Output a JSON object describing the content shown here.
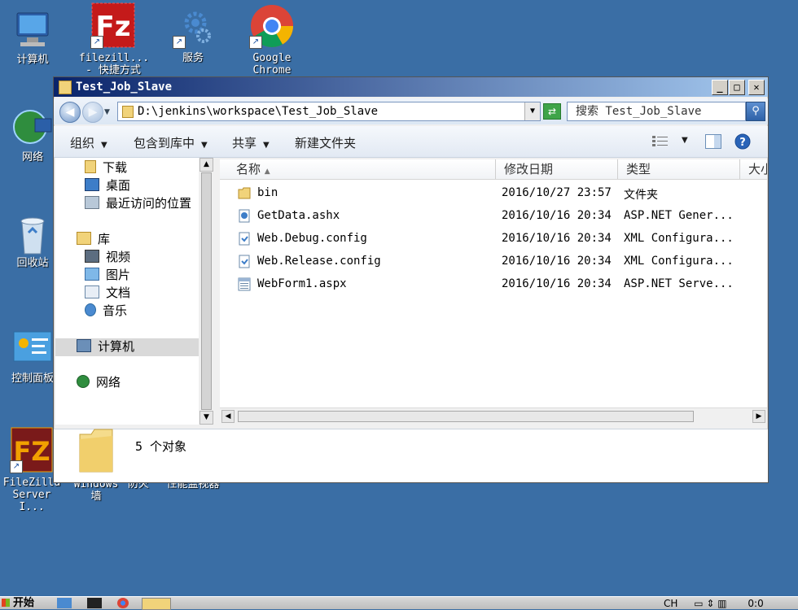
{
  "desktop": {
    "icons": [
      {
        "label": "计算机"
      },
      {
        "label": "filezill...\n- 快捷方式"
      },
      {
        "label": "服务"
      },
      {
        "label": "Google\nChrome"
      },
      {
        "label": "网络"
      },
      {
        "label": "回收站"
      },
      {
        "label": "控制面板"
      },
      {
        "label": "FileZilla\nServer I..."
      },
      {
        "label": "Windows\n墙"
      },
      {
        "label": "防火"
      },
      {
        "label": "性能监视器"
      }
    ]
  },
  "window": {
    "title": "Test_Job_Slave",
    "address": "D:\\jenkins\\workspace\\Test_Job_Slave",
    "search_placeholder": "搜索 Test_Job_Slave",
    "toolbar": {
      "organize": "组织",
      "include_in_library": "包含到库中",
      "share": "共享",
      "new_folder": "新建文件夹"
    },
    "nav": {
      "downloads": "下载",
      "desktop": "桌面",
      "recent": "最近访问的位置",
      "libraries": "库",
      "videos": "视频",
      "pictures": "图片",
      "documents": "文档",
      "music": "音乐",
      "computer": "计算机",
      "network": "网络"
    },
    "columns": {
      "name": "名称",
      "modified": "修改日期",
      "type": "类型",
      "size": "大小"
    },
    "files": [
      {
        "name": "bin",
        "modified": "2016/10/27 23:57",
        "type": "文件夹",
        "icon": "folder-icon"
      },
      {
        "name": "GetData.ashx",
        "modified": "2016/10/16 20:34",
        "type": "ASP.NET Gener...",
        "icon": "ashx-file-icon"
      },
      {
        "name": "Web.Debug.config",
        "modified": "2016/10/16 20:34",
        "type": "XML Configura...",
        "icon": "config-file-icon"
      },
      {
        "name": "Web.Release.config",
        "modified": "2016/10/16 20:34",
        "type": "XML Configura...",
        "icon": "config-file-icon"
      },
      {
        "name": "WebForm1.aspx",
        "modified": "2016/10/16 20:34",
        "type": "ASP.NET Serve...",
        "icon": "aspx-file-icon"
      }
    ],
    "status": "5 个对象"
  },
  "taskbar": {
    "start": "开始",
    "lang": "CH",
    "clock": "0:0"
  }
}
